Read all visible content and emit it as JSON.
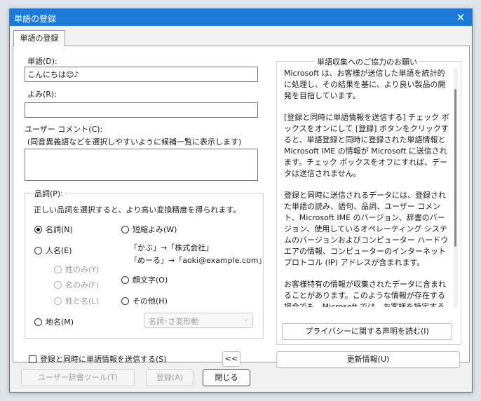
{
  "window": {
    "title": "単語の登録",
    "close": "✕"
  },
  "tab": {
    "label": "単語の登録"
  },
  "word": {
    "label": "単語(D):",
    "value": "こんにちは😊♪"
  },
  "reading": {
    "label": "よみ(R):",
    "value": ""
  },
  "comment": {
    "label": "ユーザー コメント(C):",
    "hint": "(同音異義語などを選択しやすいように候補一覧に表示します)",
    "value": ""
  },
  "pos": {
    "legend": "品詞(P):",
    "desc": "正しい品詞を選択すると、より高い変換精度を得られます。",
    "noun": "名詞(N)",
    "person": "人名(E)",
    "surname": "姓のみ(Y)",
    "givenname": "名のみ(F)",
    "fullname": "姓と名(L)",
    "place": "地名(M)",
    "abbr": "短縮よみ(W)",
    "abbr_ex1": "「かぶ」→「株式会社」",
    "abbr_ex2": "「めーる」→「aoki@example.com」",
    "emoticon": "顔文字(O)",
    "other": "その他(H)",
    "other_select": "名詞･さ変形動"
  },
  "send_checkbox": "登録と同時に単語情報を送信する(S)",
  "toggle_button": "<<",
  "notice": {
    "legend": "単語収集へのご協力のお願い",
    "paragraphs": [
      "Microsoft は、お客様が送信した単語を統計的に処理し、その結果を基に、より良い製品の開発を目指しています。",
      "[登録と同時に単語情報を送信する] チェック ボックスをオンにして [登録] ボタンをクリックすると、単語登録と同時に登録された単語情報と Microsoft IME の情報が Microsoft に送信されます。チェック ボックスをオフにすれば、データは送信されません。",
      "登録と同時に送信されるデータには、登録された単語の読み、語句、品詞、ユーザー コメント、Microsoft IME のバージョン、辞書のバージョン、使用しているオペレーティング システムのバージョンおよびコンピューター ハードウエアの情報、コンピューターのインターネット プロトコル (IP) アドレスが含まれます。",
      "お客様特有の情報が収集されたデータに含まれることがあります。このような情報が存在する場合でも、Microsoft では、お客様を特定するために使用することはありません。"
    ],
    "privacy_button": "プライバシーに関する声明を読む(I)"
  },
  "update_button": "更新情報(U)",
  "footer": {
    "dict_tool": "ユーザー辞書ツール(T)",
    "register": "登録(A)",
    "close": "閉じる"
  }
}
